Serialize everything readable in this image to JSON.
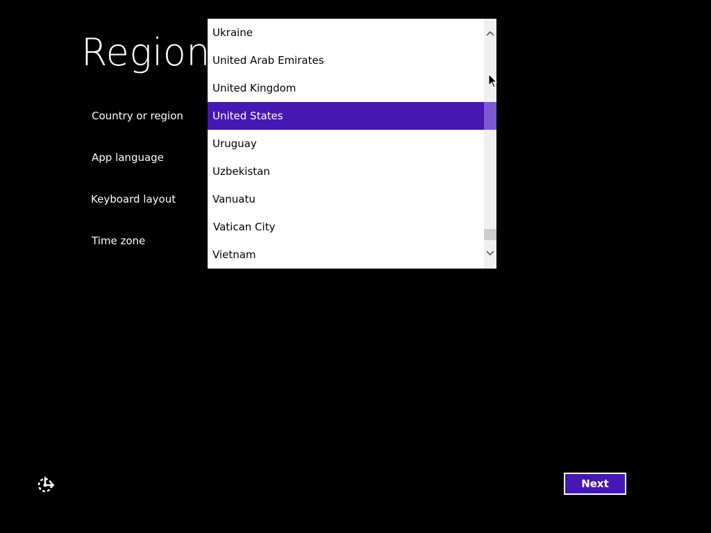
{
  "page": {
    "title": "Region"
  },
  "fields": [
    {
      "label": "Country or region"
    },
    {
      "label": "App language"
    },
    {
      "label": "Keyboard layout"
    },
    {
      "label": "Time zone"
    }
  ],
  "country_dropdown": {
    "options": [
      "Ukraine",
      "United Arab Emirates",
      "United Kingdom",
      "United States",
      "Uruguay",
      "Uzbekistan",
      "Vanuatu",
      "Vatican City",
      "Vietnam"
    ],
    "selected": "United States"
  },
  "footer": {
    "ease_of_access_icon": "ease-of-access-icon",
    "next_label": "Next"
  },
  "colors": {
    "accent": "#4617b4",
    "background": "#000000",
    "dropdown_bg": "#ffffff"
  }
}
